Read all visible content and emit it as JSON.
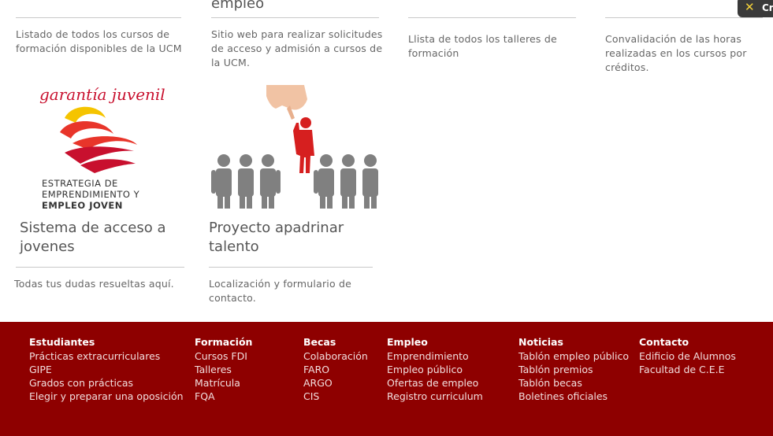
{
  "top_cards": [
    {
      "title": "empleo",
      "desc": "Sitio web para realizar solicitudes de acceso y admisión a cursos de la UCM."
    },
    {
      "desc": "Listado de todos los cursos de formación disponibles de la UCM"
    },
    {
      "desc": "Llista de todos los talleres de formación"
    },
    {
      "desc": "Convalidación de las horas realizadas en los cursos por créditos."
    }
  ],
  "cards": [
    {
      "title": "Sistema de acceso a jovenes",
      "desc": "Todas tus dudas resueltas aquí.",
      "logo": {
        "brand": "garantía juvenil",
        "line1": "ESTRATEGIA DE",
        "line2": "EMPRENDIMIENTO Y",
        "line3": "EMPLEO JOVEN"
      }
    },
    {
      "title": "Proyecto apadrinar talento",
      "desc": "Localización y formulario de contacto."
    }
  ],
  "badge": {
    "label": "Cr"
  },
  "footer": {
    "columns": [
      {
        "heading": "Estudiantes",
        "links": [
          "Prácticas extracurriculares",
          "GIPE",
          "Grados con prácticas",
          "Elegir y preparar una oposición"
        ]
      },
      {
        "heading": "Formación",
        "links": [
          "Cursos FDI",
          "Talleres",
          "Matrícula",
          "FQA"
        ]
      },
      {
        "heading": "Becas",
        "links": [
          "Colaboración",
          "FARO",
          "ARGO",
          "CIS"
        ]
      },
      {
        "heading": "Empleo",
        "links": [
          "Emprendimiento",
          "Empleo público",
          "Ofertas de empleo",
          "Registro curriculum"
        ]
      },
      {
        "heading": "Noticias",
        "links": [
          "Tablón empleo público",
          "Tablón premios",
          "Tablón becas",
          "Boletines oficiales"
        ]
      },
      {
        "heading": "Contacto",
        "links": [
          "Edificio de Alumnos",
          "Facultad de C.E.E"
        ]
      }
    ]
  },
  "colors": {
    "footer_bg": "#8e0000",
    "brand_red": "#c8102e",
    "figure_gray": "#808080"
  }
}
